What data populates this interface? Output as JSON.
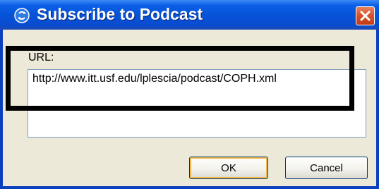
{
  "window": {
    "title": "Subscribe to Podcast",
    "app_icon": "podcast-icon",
    "close_icon": "close-icon"
  },
  "form": {
    "url_label": "URL:",
    "url_value": "http://www.itt.usf.edu/lplescia/podcast/COPH.xml"
  },
  "buttons": {
    "ok_label": "OK",
    "cancel_label": "Cancel"
  },
  "colors": {
    "titlebar": "#0a5fe6",
    "close_button": "#d8532b",
    "dialog_face": "#ece9d8",
    "highlight_frame": "#000000"
  }
}
